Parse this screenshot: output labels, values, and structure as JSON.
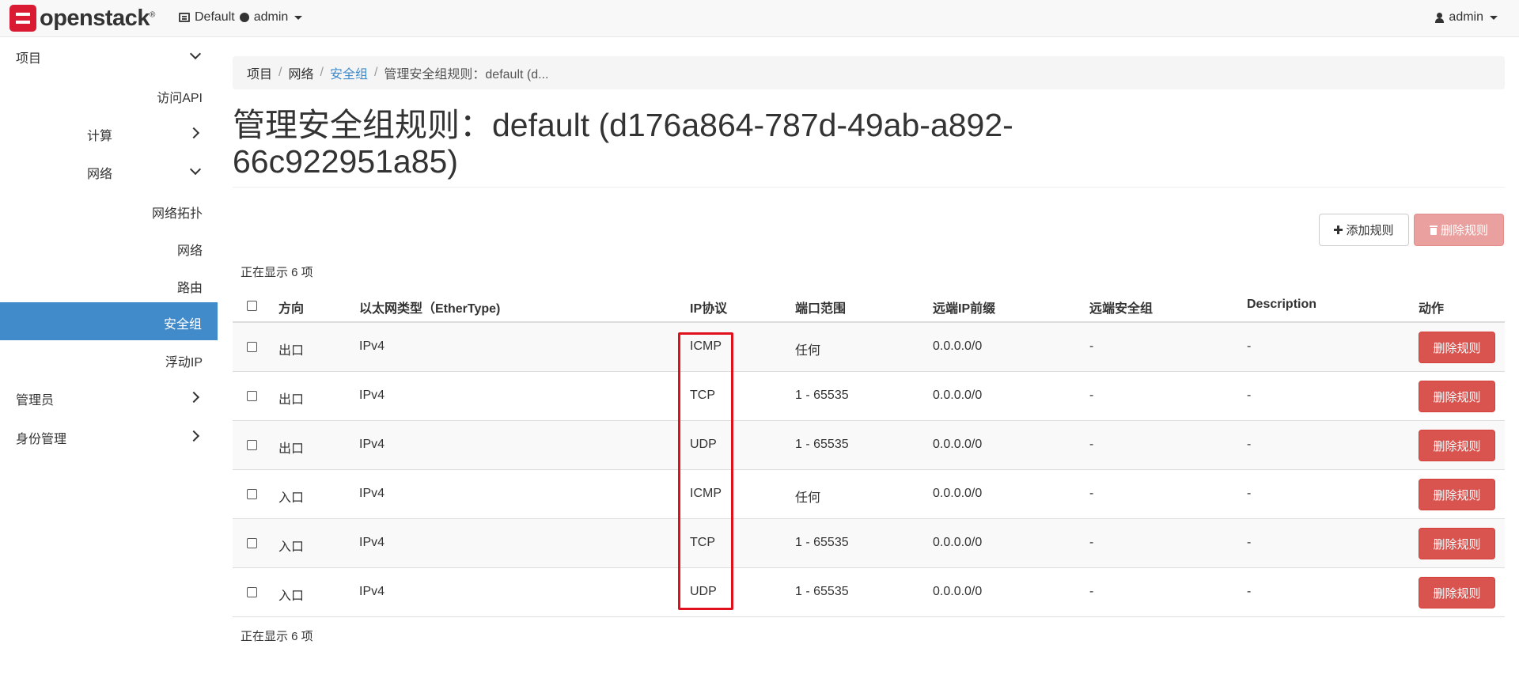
{
  "navbar": {
    "brand": "openstack",
    "brand_mark": "®",
    "domain": "Default",
    "project": "admin",
    "user": "admin",
    "icons": [
      "openstack-logo",
      "list-icon",
      "project-dot-icon",
      "user-icon",
      "caret-down-icon"
    ]
  },
  "sidebar": {
    "project": "项目",
    "api_access": "访问API",
    "compute": "计算",
    "network": "网络",
    "network_topology": "网络拓扑",
    "networks": "网络",
    "routers": "路由",
    "security_groups": "安全组",
    "floating_ips": "浮动IP",
    "admin": "管理员",
    "identity": "身份管理",
    "active_color": "#428bca"
  },
  "breadcrumb": {
    "items": [
      "项目",
      "网络",
      "安全组",
      "管理安全组规则：default (d..."
    ],
    "separator": "/"
  },
  "page": {
    "title_line1": "管理安全组规则：default (d176a864-787d-49ab-a892-",
    "title_line2": "66c922951a85)"
  },
  "toolbar": {
    "add_rule": "添加规则",
    "delete_rules": "删除规则"
  },
  "table": {
    "count_top": "正在显示 6 项",
    "count_bottom": "正在显示 6 项",
    "headers": {
      "direction": "方向",
      "ethertype": "以太网类型（EtherType)",
      "protocol": "IP协议",
      "port_range": "端口范围",
      "remote_prefix": "远端IP前缀",
      "remote_group": "远端安全组",
      "description": "Description",
      "actions": "动作"
    },
    "rows": [
      {
        "direction": "出口",
        "ethertype": "IPv4",
        "protocol": "ICMP",
        "port_range": "任何",
        "remote_prefix": "0.0.0.0/0",
        "remote_group": "-",
        "description": "-",
        "action": "删除规则"
      },
      {
        "direction": "出口",
        "ethertype": "IPv4",
        "protocol": "TCP",
        "port_range": "1 - 65535",
        "remote_prefix": "0.0.0.0/0",
        "remote_group": "-",
        "description": "-",
        "action": "删除规则"
      },
      {
        "direction": "出口",
        "ethertype": "IPv4",
        "protocol": "UDP",
        "port_range": "1 - 65535",
        "remote_prefix": "0.0.0.0/0",
        "remote_group": "-",
        "description": "-",
        "action": "删除规则"
      },
      {
        "direction": "入口",
        "ethertype": "IPv4",
        "protocol": "ICMP",
        "port_range": "任何",
        "remote_prefix": "0.0.0.0/0",
        "remote_group": "-",
        "description": "-",
        "action": "删除规则"
      },
      {
        "direction": "入口",
        "ethertype": "IPv4",
        "protocol": "TCP",
        "port_range": "1 - 65535",
        "remote_prefix": "0.0.0.0/0",
        "remote_group": "-",
        "description": "-",
        "action": "删除规则"
      },
      {
        "direction": "入口",
        "ethertype": "IPv4",
        "protocol": "UDP",
        "port_range": "1 - 65535",
        "remote_prefix": "0.0.0.0/0",
        "remote_group": "-",
        "description": "-",
        "action": "删除规则"
      }
    ]
  },
  "colors": {
    "danger": "#d9534f",
    "danger_disabled": "#e9a09e",
    "highlight_box": "#e0111d",
    "link": "#428bca"
  }
}
